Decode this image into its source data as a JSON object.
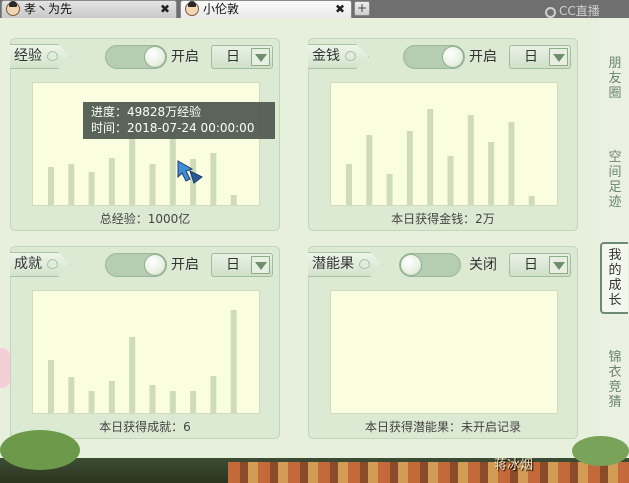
{
  "tabs": [
    {
      "label": "孝丶为先",
      "close": "✖"
    },
    {
      "label": "小伦敦",
      "close": "✖"
    }
  ],
  "new_tab": "+",
  "brand": "CC直播",
  "panels": [
    {
      "title": "经验",
      "toggle_state": "on",
      "toggle_label": "开启",
      "select_value": "日",
      "caption": "总经验：1000亿",
      "bar_color": "#cfdcbc",
      "chart_data": {
        "type": "bar",
        "values": [
          38,
          41,
          33,
          47,
          74,
          41,
          88,
          46,
          52,
          10
        ]
      }
    },
    {
      "title": "金钱",
      "toggle_state": "on",
      "toggle_label": "开启",
      "select_value": "日",
      "caption": "本日获得金钱：2万",
      "bar_color": "#cfdcbc",
      "chart_data": {
        "type": "bar",
        "values": [
          41,
          70,
          31,
          74,
          96,
          49,
          90,
          63,
          83,
          9
        ]
      }
    },
    {
      "title": "成就",
      "toggle_state": "on",
      "toggle_label": "开启",
      "select_value": "日",
      "caption": "本日获得成就：6",
      "bar_color": "#cfdcbc",
      "chart_data": {
        "type": "bar",
        "values": [
          53,
          36,
          22,
          32,
          76,
          28,
          22,
          22,
          37,
          103
        ]
      }
    },
    {
      "title": "潜能果",
      "toggle_state": "off",
      "toggle_label": "关闭",
      "select_value": "日",
      "caption": "本日获得潜能果：未开启记录",
      "bar_color": "#cfdcbc",
      "chart_data": {
        "type": "bar",
        "values": []
      }
    }
  ],
  "tooltip": {
    "line1": "进度：49828万经验",
    "line2": "时间：2018-07-24 00:00:00"
  },
  "side_tabs": [
    {
      "label": "朋\n友\n圈"
    },
    {
      "label": "空\n间\n足\n迹"
    },
    {
      "label": "我\n的\n成\n长"
    },
    {
      "label": "锦\n衣\n竞\n猜"
    }
  ],
  "footer": {
    "name": "蒋冰烟"
  }
}
